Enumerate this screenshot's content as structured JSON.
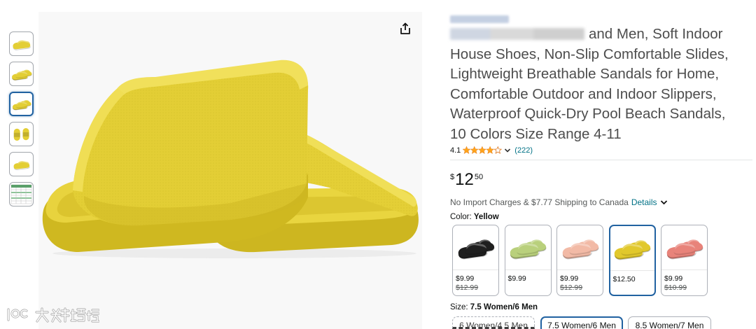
{
  "gallery": {
    "selected_thumbnail_index": 2
  },
  "product": {
    "title_lines": [
      "and Men, Soft Indoor",
      "House Shoes, Non-Slip Comfortable Slides,",
      "Lightweight Breathable Sandals for Home,",
      "Comfortable Outdoor and Indoor Slippers,",
      "Waterproof Quick-Dry Pool Beach Sandals,",
      "10 Colors Size Range 4-11"
    ],
    "rating": "4.1",
    "rating_count": "(222)",
    "price": {
      "symbol": "$",
      "whole": "12",
      "fraction": "50"
    },
    "shipping": {
      "text": "No Import Charges & $7.77 Shipping to Canada",
      "details_link": "Details"
    },
    "color": {
      "label": "Color:",
      "selected": "Yellow",
      "options": [
        {
          "hex": "#1f1f1f",
          "price": "$9.99",
          "list_price": "$12.99"
        },
        {
          "hex": "#b9d07c",
          "price": "$9.99"
        },
        {
          "hex": "#f2baa6",
          "price": "$9.99",
          "list_price": "$12.99"
        },
        {
          "hex": "#e1c82c",
          "price": "$12.50",
          "selected": true
        },
        {
          "hex": "#e8837a",
          "price": "$9.99",
          "list_price": "$10.99"
        }
      ]
    },
    "size": {
      "label": "Size:",
      "selected": "7.5 Women/6 Men",
      "options": [
        {
          "label": "6 Women/4.5 Men",
          "state": "unavailable"
        },
        {
          "label": "7.5 Women/6 Men",
          "state": "selected"
        },
        {
          "label": "8.5 Women/7 Men",
          "state": "available"
        }
      ]
    }
  },
  "theme": {
    "link": "#007185",
    "star": "#FFA41C",
    "star_outline": "#DE7921",
    "selected_border": "#2162A1",
    "text": "#0F1111",
    "muted": "#565959",
    "product_yellow": "#E3CE35"
  },
  "icons": {
    "share": "share-icon",
    "dropdown": "chevron-down-icon",
    "star": "star-icon"
  },
  "watermark": {
    "text": "大数跨境"
  }
}
